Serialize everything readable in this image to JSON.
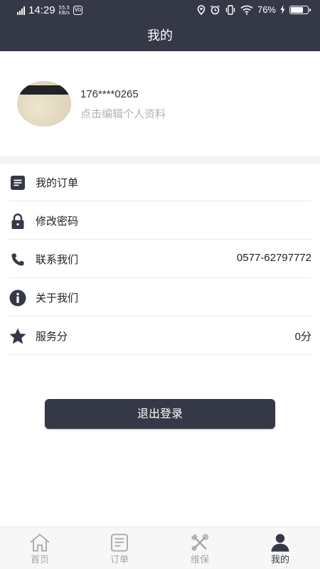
{
  "status_bar": {
    "network": "4G HD",
    "time": "14:29",
    "speed_value": "55.5",
    "speed_unit": "KB/s",
    "battery_text": "76%",
    "battery_level": 0.76
  },
  "header": {
    "title": "我的"
  },
  "profile": {
    "phone": "176****0265",
    "edit_text": "点击编辑个人资料"
  },
  "menu": [
    {
      "label": "我的订单",
      "value": "",
      "icon": "order-list-icon"
    },
    {
      "label": "修改密码",
      "value": "",
      "icon": "lock-icon"
    },
    {
      "label": "联系我们",
      "value": "0577-62797772",
      "icon": "phone-icon"
    },
    {
      "label": "关于我们",
      "value": "",
      "icon": "info-icon"
    },
    {
      "label": "服务分",
      "value": "0分",
      "icon": "star-icon"
    }
  ],
  "logout_label": "退出登录",
  "tabs": [
    {
      "label": "首页",
      "icon": "home-icon",
      "active": false
    },
    {
      "label": "订单",
      "icon": "order-icon",
      "active": false
    },
    {
      "label": "维保",
      "icon": "tools-icon",
      "active": false
    },
    {
      "label": "我的",
      "icon": "user-icon",
      "active": true
    }
  ],
  "colors": {
    "primary": "#343847",
    "muted": "#a5a5a5",
    "background_gap": "#f4f4f4"
  }
}
